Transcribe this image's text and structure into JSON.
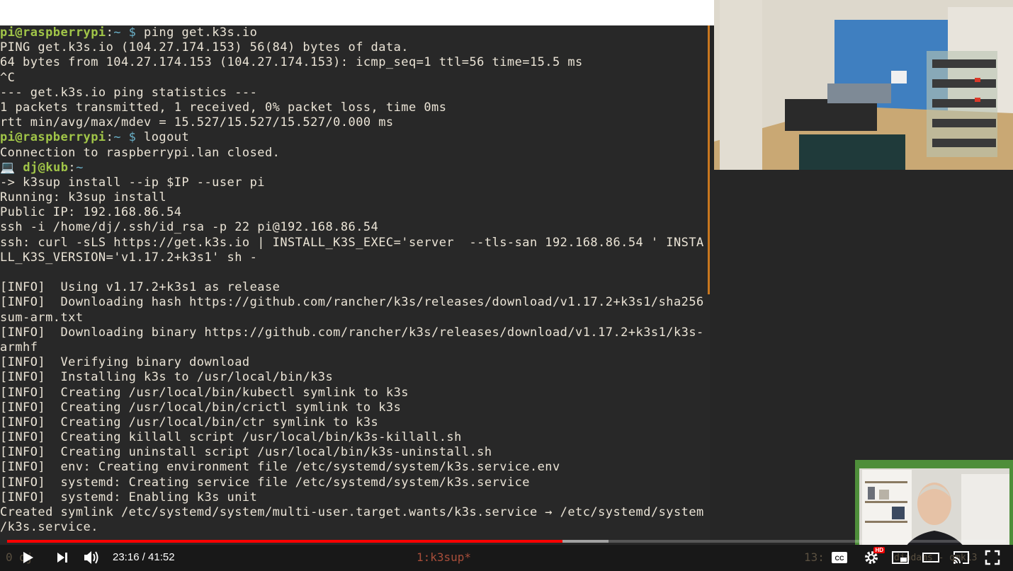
{
  "terminal": {
    "lines": [
      {
        "type": "prompt-pi",
        "user": "pi@raspberrypi",
        "sep": ":",
        "dir": "~",
        "dollar": "$",
        "cmd": " ping get.k3s.io"
      },
      {
        "type": "text",
        "text": "PING get.k3s.io (104.27.174.153) 56(84) bytes of data."
      },
      {
        "type": "text",
        "text": "64 bytes from 104.27.174.153 (104.27.174.153): icmp_seq=1 ttl=56 time=15.5 ms"
      },
      {
        "type": "text",
        "text": "^C"
      },
      {
        "type": "text",
        "text": "--- get.k3s.io ping statistics ---"
      },
      {
        "type": "text",
        "text": "1 packets transmitted, 1 received, 0% packet loss, time 0ms"
      },
      {
        "type": "text",
        "text": "rtt min/avg/max/mdev = 15.527/15.527/15.527/0.000 ms"
      },
      {
        "type": "prompt-pi",
        "user": "pi@raspberrypi",
        "sep": ":",
        "dir": "~",
        "dollar": "$",
        "cmd": " logout"
      },
      {
        "type": "text",
        "text": "Connection to raspberrypi.lan closed."
      },
      {
        "type": "prompt-kub",
        "icon": "💻",
        "user": "dj@kub",
        "sep": ":",
        "dir": "~"
      },
      {
        "type": "text",
        "text": "-> k3sup install --ip $IP --user pi"
      },
      {
        "type": "text",
        "text": "Running: k3sup install"
      },
      {
        "type": "text",
        "text": "Public IP: 192.168.86.54"
      },
      {
        "type": "text",
        "text": "ssh -i /home/dj/.ssh/id_rsa -p 22 pi@192.168.86.54"
      },
      {
        "type": "text",
        "text": "ssh: curl -sLS https://get.k3s.io | INSTALL_K3S_EXEC='server  --tls-san 192.168.86.54 ' INSTA"
      },
      {
        "type": "text",
        "text": "LL_K3S_VERSION='v1.17.2+k3s1' sh -"
      },
      {
        "type": "text",
        "text": ""
      },
      {
        "type": "text",
        "text": "[INFO]  Using v1.17.2+k3s1 as release"
      },
      {
        "type": "text",
        "text": "[INFO]  Downloading hash https://github.com/rancher/k3s/releases/download/v1.17.2+k3s1/sha256"
      },
      {
        "type": "text",
        "text": "sum-arm.txt"
      },
      {
        "type": "text",
        "text": "[INFO]  Downloading binary https://github.com/rancher/k3s/releases/download/v1.17.2+k3s1/k3s-"
      },
      {
        "type": "text",
        "text": "armhf"
      },
      {
        "type": "text",
        "text": "[INFO]  Verifying binary download"
      },
      {
        "type": "text",
        "text": "[INFO]  Installing k3s to /usr/local/bin/k3s"
      },
      {
        "type": "text",
        "text": "[INFO]  Creating /usr/local/bin/kubectl symlink to k3s"
      },
      {
        "type": "text",
        "text": "[INFO]  Creating /usr/local/bin/crictl symlink to k3s"
      },
      {
        "type": "text",
        "text": "[INFO]  Creating /usr/local/bin/ctr symlink to k3s"
      },
      {
        "type": "text",
        "text": "[INFO]  Creating killall script /usr/local/bin/k3s-killall.sh"
      },
      {
        "type": "text",
        "text": "[INFO]  Creating uninstall script /usr/local/bin/k3s-uninstall.sh"
      },
      {
        "type": "text",
        "text": "[INFO]  env: Creating environment file /etc/systemd/system/k3s.service.env"
      },
      {
        "type": "text",
        "text": "[INFO]  systemd: Creating service file /etc/systemd/system/k3s.service"
      },
      {
        "type": "text",
        "text": "[INFO]  systemd: Enabling k3s unit"
      },
      {
        "type": "text",
        "text": "Created symlink /etc/systemd/system/multi-user.target.wants/k3s.service → /etc/systemd/system"
      },
      {
        "type": "text",
        "text": "/k3s.service."
      }
    ]
  },
  "tmux": {
    "left": "0 dj",
    "active_window": "1:k3sup*",
    "right_index": "13:",
    "right_host": "djadams - qmk13"
  },
  "player": {
    "time_current": "23:16",
    "time_total": "41:52",
    "time_display": "23:16 / 41:52",
    "progress_fraction": 0.556,
    "buffered_fraction": 0.602,
    "hd_badge": "HD",
    "colors": {
      "played": "#ff0000",
      "accent_green": "#4e8e3a"
    },
    "icons": [
      "play-icon",
      "next-icon",
      "volume-icon",
      "captions-icon",
      "settings-icon",
      "miniplayer-icon",
      "theater-icon",
      "cast-icon",
      "fullscreen-icon"
    ]
  }
}
